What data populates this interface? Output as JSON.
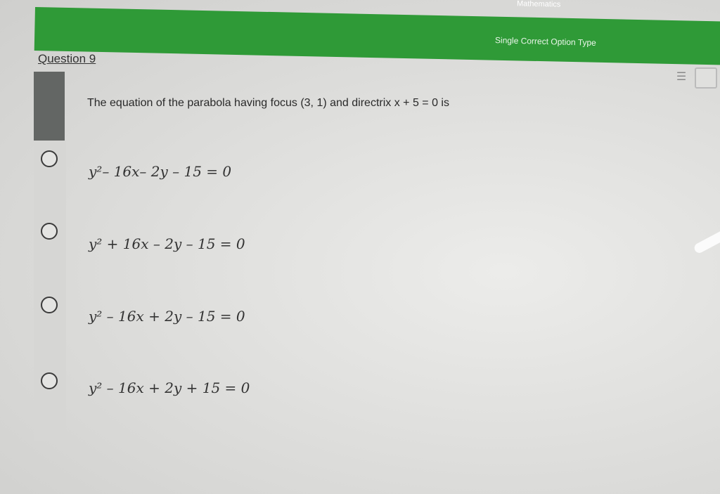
{
  "header": {
    "subject": "Mathematics",
    "question_type": "Single Correct Option Type"
  },
  "question": {
    "number_label": "Question 9",
    "text": "The equation of the parabola having focus (3, 1) and directrix x + 5 = 0 is"
  },
  "options": [
    {
      "text": "y²– 16x– 2y – 15 = 0"
    },
    {
      "text": "y² + 16x – 2y – 15 = 0"
    },
    {
      "text": "y² – 16x + 2y – 15 = 0"
    },
    {
      "text": "y² – 16x + 2y + 15 = 0"
    }
  ],
  "icons": {
    "menu": "list-icon",
    "palette": "grid-icon"
  },
  "colors": {
    "header_green": "#2f9a37",
    "side_dark": "#636664"
  }
}
